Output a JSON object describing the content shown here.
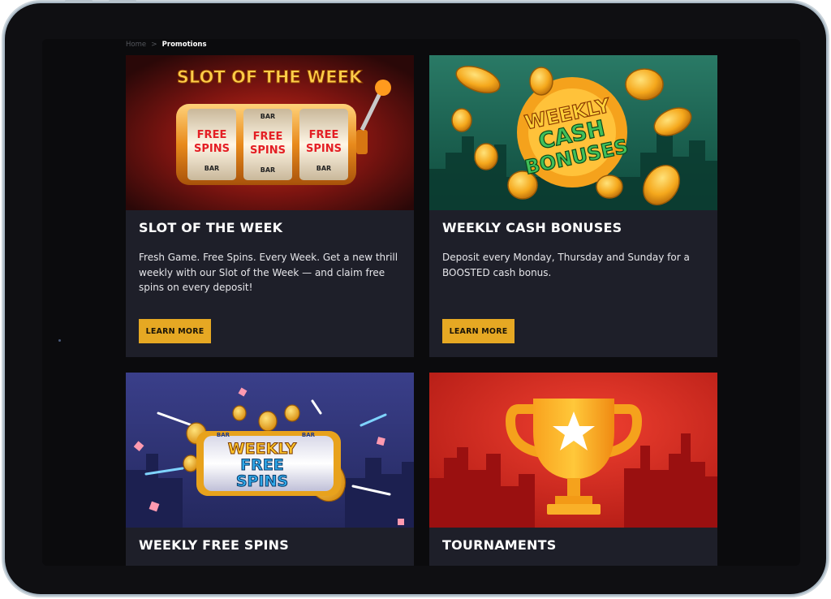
{
  "breadcrumb": {
    "home": "Home",
    "separator": ">",
    "current": "Promotions"
  },
  "promotions": [
    {
      "art_title": "SLOT OF THE WEEK",
      "art_reel_text": [
        "FREE SPINS",
        "FREE SPINS",
        "FREE SPINS"
      ],
      "art_bar_text": "BAR",
      "title": "SLOT OF THE WEEK",
      "description": "Fresh Game. Free Spins. Every Week. Get a new thrill weekly with our Slot of the Week — and claim free spins on every deposit!",
      "button": "LEARN MORE"
    },
    {
      "art_line1": "WEEKLY",
      "art_line2": "CASH",
      "art_line3": "BONUSES",
      "title": "WEEKLY CASH BONUSES",
      "description": "Deposit every Monday, Thursday and Sunday for a BOOSTED cash bonus.",
      "button": "LEARN MORE"
    },
    {
      "art_line1": "WEEKLY",
      "art_line2": "FREE",
      "art_line3": "SPINS",
      "art_bar_text": "BAR",
      "title": "WEEKLY FREE SPINS"
    },
    {
      "title": "TOURNAMENTS"
    }
  ],
  "colors": {
    "card_bg": "#1e1f29",
    "button_bg": "#e6a823",
    "page_bg": "#0b0b0d"
  }
}
